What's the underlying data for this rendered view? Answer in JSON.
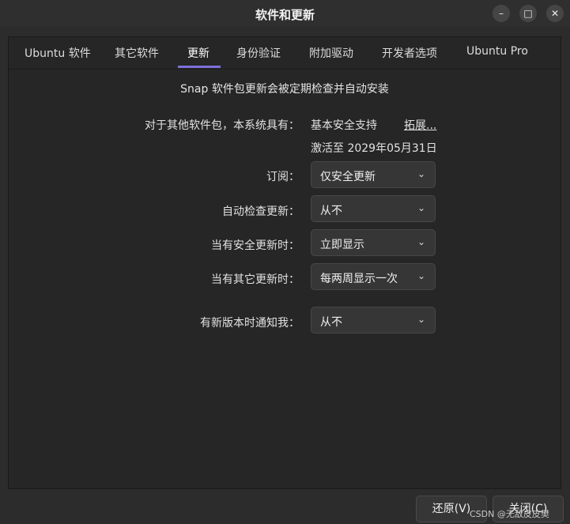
{
  "window": {
    "title": "软件和更新",
    "controls": [
      "minimize-icon",
      "maximize-icon",
      "close-icon"
    ]
  },
  "tabs": [
    {
      "label": "Ubuntu 软件"
    },
    {
      "label": "其它软件"
    },
    {
      "label": "更新",
      "active": true
    },
    {
      "label": "身份验证"
    },
    {
      "label": "附加驱动"
    },
    {
      "label": "开发者选项"
    },
    {
      "label": "Ubuntu Pro"
    }
  ],
  "updates": {
    "snap_note": "Snap 软件包更新会被定期检查并自动安装",
    "other_packages_label": "对于其他软件包，本系统具有：",
    "support_value": "基本安全支持",
    "expand_link": "拓展...",
    "activation_text": "激活至 2029年05月31日",
    "subscription": {
      "label": "订阅：",
      "value": "仅安全更新"
    },
    "auto_check": {
      "label": "自动检查更新：",
      "value": "从不"
    },
    "security_updates": {
      "label": "当有安全更新时：",
      "value": "立即显示"
    },
    "other_updates": {
      "label": "当有其它更新时：",
      "value": "每两周显示一次"
    },
    "new_version_notify": {
      "label": "有新版本时通知我：",
      "value": "从不"
    }
  },
  "buttons": {
    "revert": "还原(V)",
    "close": "关闭(C)"
  },
  "watermark": "CSDN @无敌皮皮樊",
  "colors": {
    "background": "#2c2c2c",
    "tab_accent": "#7c6fd8"
  }
}
